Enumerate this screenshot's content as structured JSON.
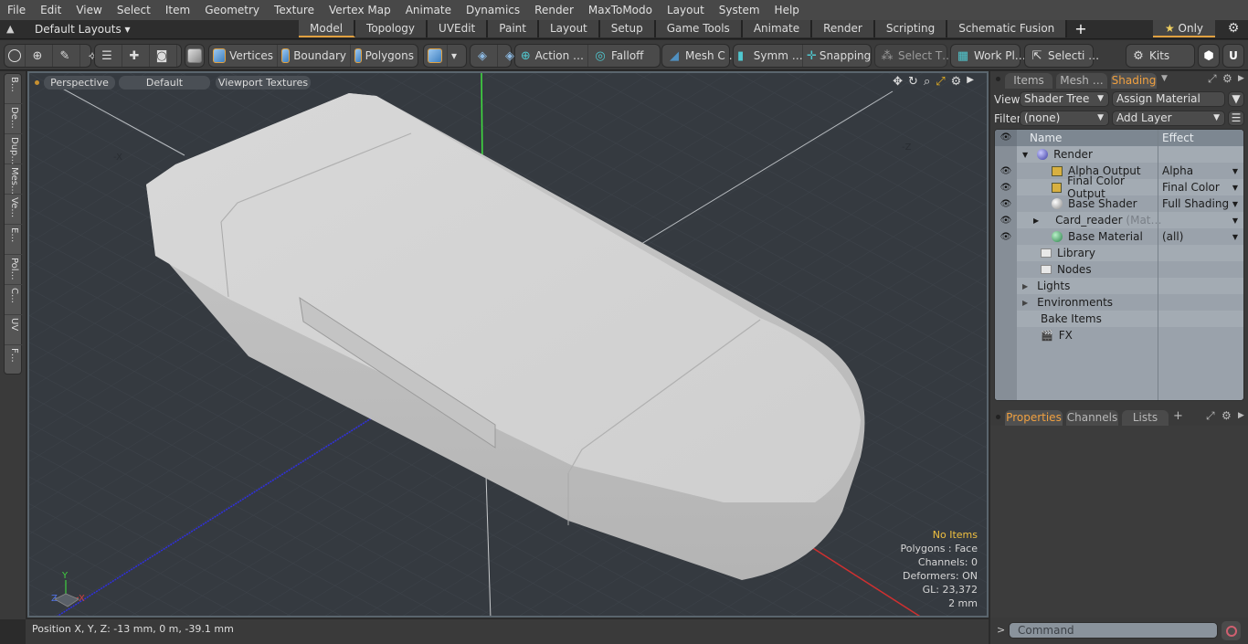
{
  "menu": [
    "File",
    "Edit",
    "View",
    "Select",
    "Item",
    "Geometry",
    "Texture",
    "Vertex Map",
    "Animate",
    "Dynamics",
    "Render",
    "MaxToModo",
    "Layout",
    "System",
    "Help"
  ],
  "layout_bar": {
    "layouts_label": "Default Layouts",
    "tabs": [
      "Model",
      "Topology",
      "UVEdit",
      "Paint",
      "Layout",
      "Setup",
      "Game Tools",
      "Animate",
      "Render",
      "Scripting",
      "Schematic Fusion"
    ],
    "active_tab": "Model",
    "add_tab": "+",
    "only_label": "Only"
  },
  "toolbar": {
    "mode_buttons": [
      "Vertices",
      "Boundary",
      "Polygons"
    ],
    "tools": [
      "Action …",
      "Falloff",
      "Mesh C …",
      "Symm …",
      "Snapping",
      "Select T…",
      "Work Pl…",
      "Selecti …",
      "Kits"
    ]
  },
  "left_tabs": [
    "B…",
    "De…",
    "Dup…",
    "Mes…",
    "Ve…",
    "E…",
    "Pol…",
    "C…",
    "UV",
    "F…"
  ],
  "viewport": {
    "view_label": "Perspective",
    "shading_label": "Default",
    "texture_label": "Viewport Textures",
    "axis_labels": {
      "neg_x": "-X",
      "neg_z": "-Z"
    },
    "gizmo": {
      "x": "X",
      "y": "Y",
      "z": "Z"
    },
    "hud": {
      "selection": "No Items",
      "polygons": "Polygons : Face",
      "channels": "Channels: 0",
      "deformers": "Deformers: ON",
      "gl": "GL: 23,372",
      "grid": "2 mm"
    }
  },
  "status": {
    "position": "Position X, Y, Z:   -13 mm, 0 m, -39.1 mm"
  },
  "right_panel": {
    "tabs": [
      "Items",
      "Mesh …",
      "Shading"
    ],
    "active_tab": "Shading",
    "view_label": "View",
    "view_value": "Shader Tree",
    "assign_material": "Assign Material",
    "filter_label": "Filter",
    "filter_value": "(none)",
    "add_layer": "Add Layer",
    "columns": {
      "name": "Name",
      "effect": "Effect"
    },
    "tree": [
      {
        "name": "Render",
        "effect": "",
        "icon": "render-ball"
      },
      {
        "name": "Alpha Output",
        "effect": "Alpha",
        "icon": "image"
      },
      {
        "name": "Final Color Output",
        "effect": "Final Color",
        "icon": "image"
      },
      {
        "name": "Base Shader",
        "effect": "Full Shading",
        "icon": "shader-ball"
      },
      {
        "name": "Card_reader",
        "suffix": "(Mat…",
        "effect": "",
        "icon": "material-group"
      },
      {
        "name": "Base Material",
        "effect": "(all)",
        "icon": "material-ball"
      },
      {
        "name": "Library",
        "icon": "folder"
      },
      {
        "name": "Nodes",
        "icon": "folder"
      },
      {
        "name": "Lights"
      },
      {
        "name": "Environments"
      },
      {
        "name": "Bake Items"
      },
      {
        "name": "FX",
        "icon": "clapper"
      }
    ],
    "bottom_tabs": [
      "Properties",
      "Channels",
      "Lists"
    ],
    "bottom_active": "Properties"
  },
  "command": {
    "placeholder": "Command",
    "prompt": ">"
  }
}
